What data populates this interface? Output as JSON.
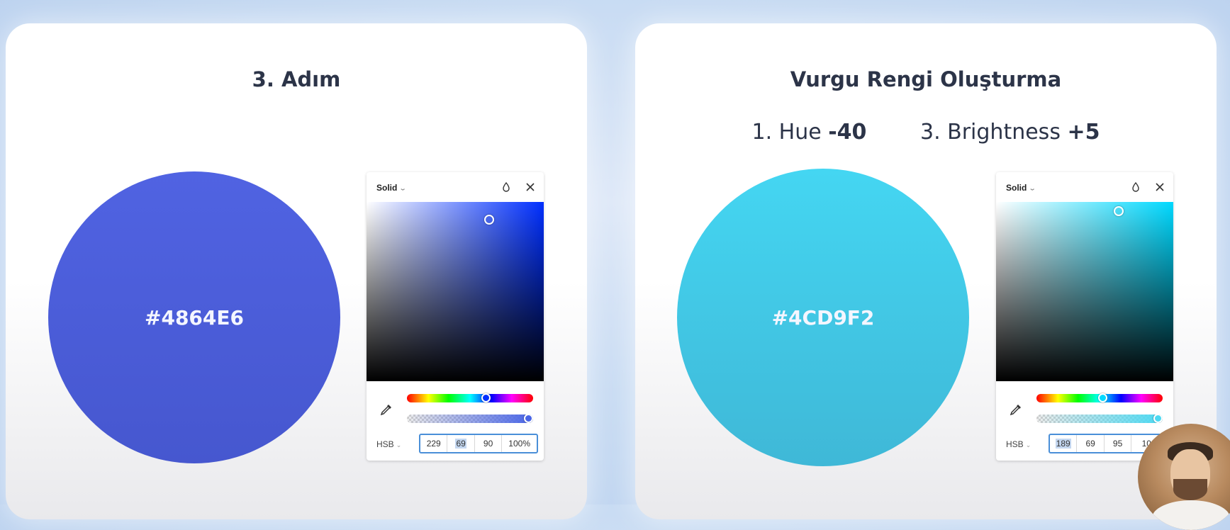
{
  "left_card": {
    "title": "3. Adım",
    "swatch_hex": "#4864E6",
    "picker": {
      "fill_type": "Solid",
      "mode": "HSB",
      "values": [
        "229",
        "69",
        "90",
        "100%"
      ],
      "highlighted_field": 1,
      "hue": 229,
      "saturation": 69,
      "brightness": 90,
      "opacity": 100
    }
  },
  "right_card": {
    "title": "Vurgu Rengi Oluşturma",
    "steps": [
      {
        "label": "1. Hue",
        "delta": "-40"
      },
      {
        "label": "3. Brightness",
        "delta": "+5"
      }
    ],
    "swatch_hex": "#4CD9F2",
    "picker": {
      "fill_type": "Solid",
      "mode": "HSB",
      "values": [
        "189",
        "69",
        "95",
        "100"
      ],
      "highlighted_field": 0,
      "hue": 189,
      "saturation": 69,
      "brightness": 95,
      "opacity": 100
    }
  },
  "colors": {
    "blue": "#4864E6",
    "cyan": "#4CD9F2",
    "title_text": "#2C3448",
    "field_border": "#4A8FD8"
  },
  "icons": [
    "drop-icon",
    "close-icon",
    "eyedropper-icon",
    "chevron-down-icon"
  ]
}
